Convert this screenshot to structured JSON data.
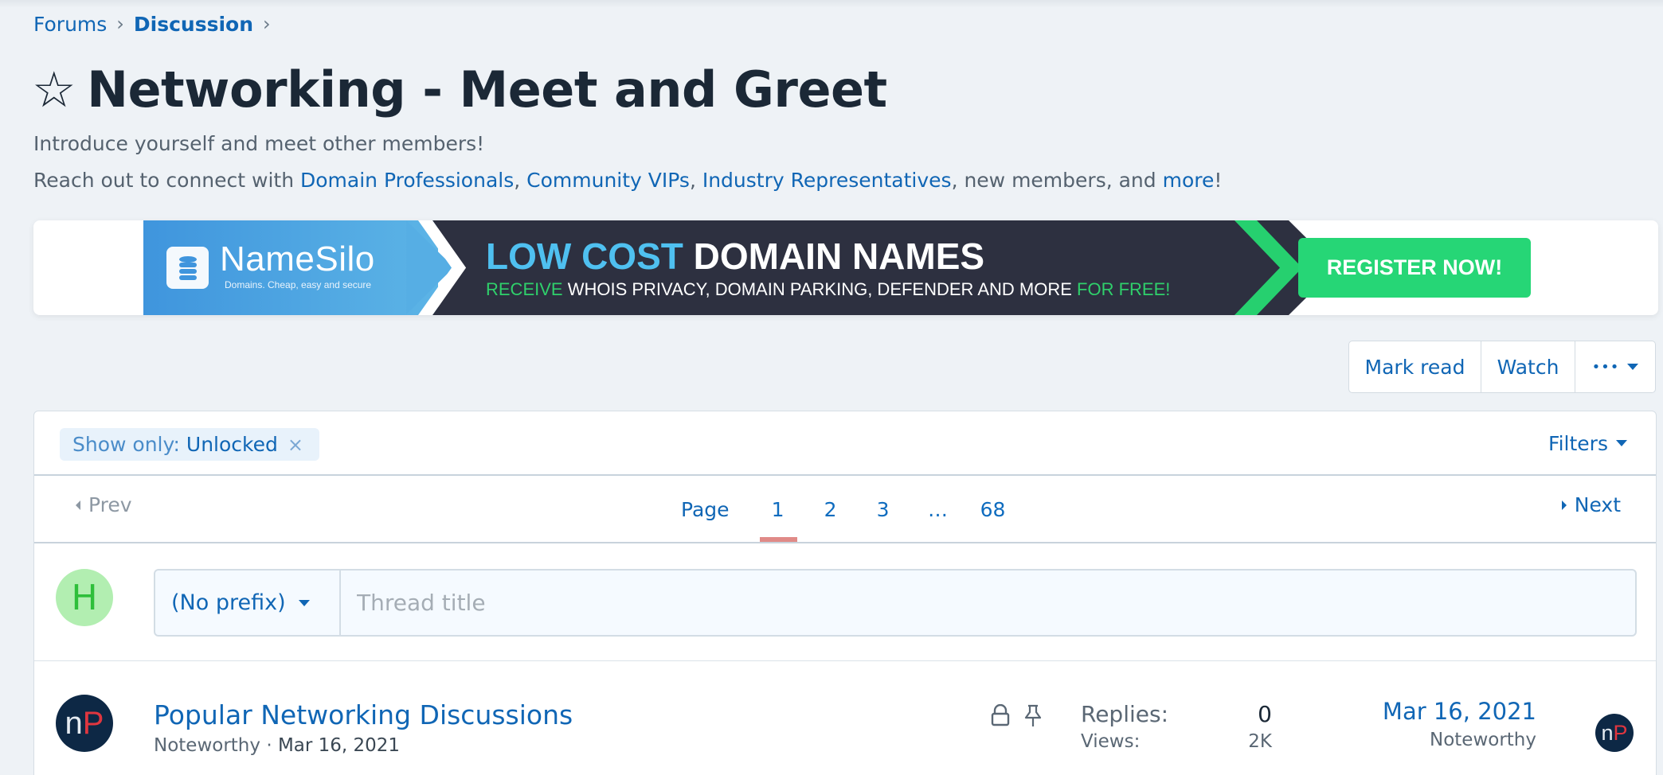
{
  "breadcrumb": [
    {
      "label": "Forums",
      "bold": false
    },
    {
      "label": "Discussion",
      "bold": true
    }
  ],
  "breadcrumb_separator": "›",
  "page": {
    "title_icon": "star-outline-icon",
    "title": "Networking - Meet and Greet",
    "description_line1": "Introduce yourself and meet other members!",
    "description_line2": {
      "prefix": "Reach out to connect with ",
      "links": [
        "Domain Professionals",
        "Community VIPs",
        "Industry Representatives"
      ],
      "middle": ", new members, and ",
      "more_link": "more",
      "suffix": "!"
    }
  },
  "banner": {
    "brand": "NameSilo",
    "tagline": "Domains. Cheap, easy and secure",
    "headline_part1": "LOW COST",
    "headline_part2": "DOMAIN NAMES",
    "sub_prefix": "RECEIVE",
    "sub_middle": " WHOIS PRIVACY, DOMAIN PARKING, DEFENDER AND MORE ",
    "sub_suffix": "FOR FREE!",
    "cta": "REGISTER NOW!",
    "colors": {
      "blue": "#3f95dd",
      "dark": "#2d3040",
      "green": "#26d676",
      "accent_blue": "#4fc0f0"
    }
  },
  "actions": {
    "mark_read": "Mark read",
    "watch": "Watch",
    "more": "•••"
  },
  "filters": {
    "chip_label": "Show only:",
    "chip_value": "Unlocked",
    "chip_remove": "×",
    "filters_label": "Filters"
  },
  "pagination": {
    "prev": "Prev",
    "next": "Next",
    "page_label": "Page",
    "pages": [
      "1",
      "2",
      "3",
      "…",
      "68"
    ],
    "current": "1"
  },
  "new_thread": {
    "avatar_letter": "H",
    "prefix_value": "(No prefix)",
    "title_placeholder": "Thread title"
  },
  "threads": [
    {
      "title": "Popular Networking Discussions",
      "author": "Noteworthy",
      "date": "Mar 16, 2021",
      "locked": true,
      "sticky": true,
      "replies_label": "Replies:",
      "replies": "0",
      "views_label": "Views:",
      "views": "2K",
      "last_date": "Mar 16, 2021",
      "last_user": "Noteworthy",
      "avatar_text_1": "n",
      "avatar_text_2": "P"
    }
  ],
  "colors": {
    "link": "#1066b5",
    "background": "#eef2f6",
    "current_page_marker": "#e08a87"
  }
}
